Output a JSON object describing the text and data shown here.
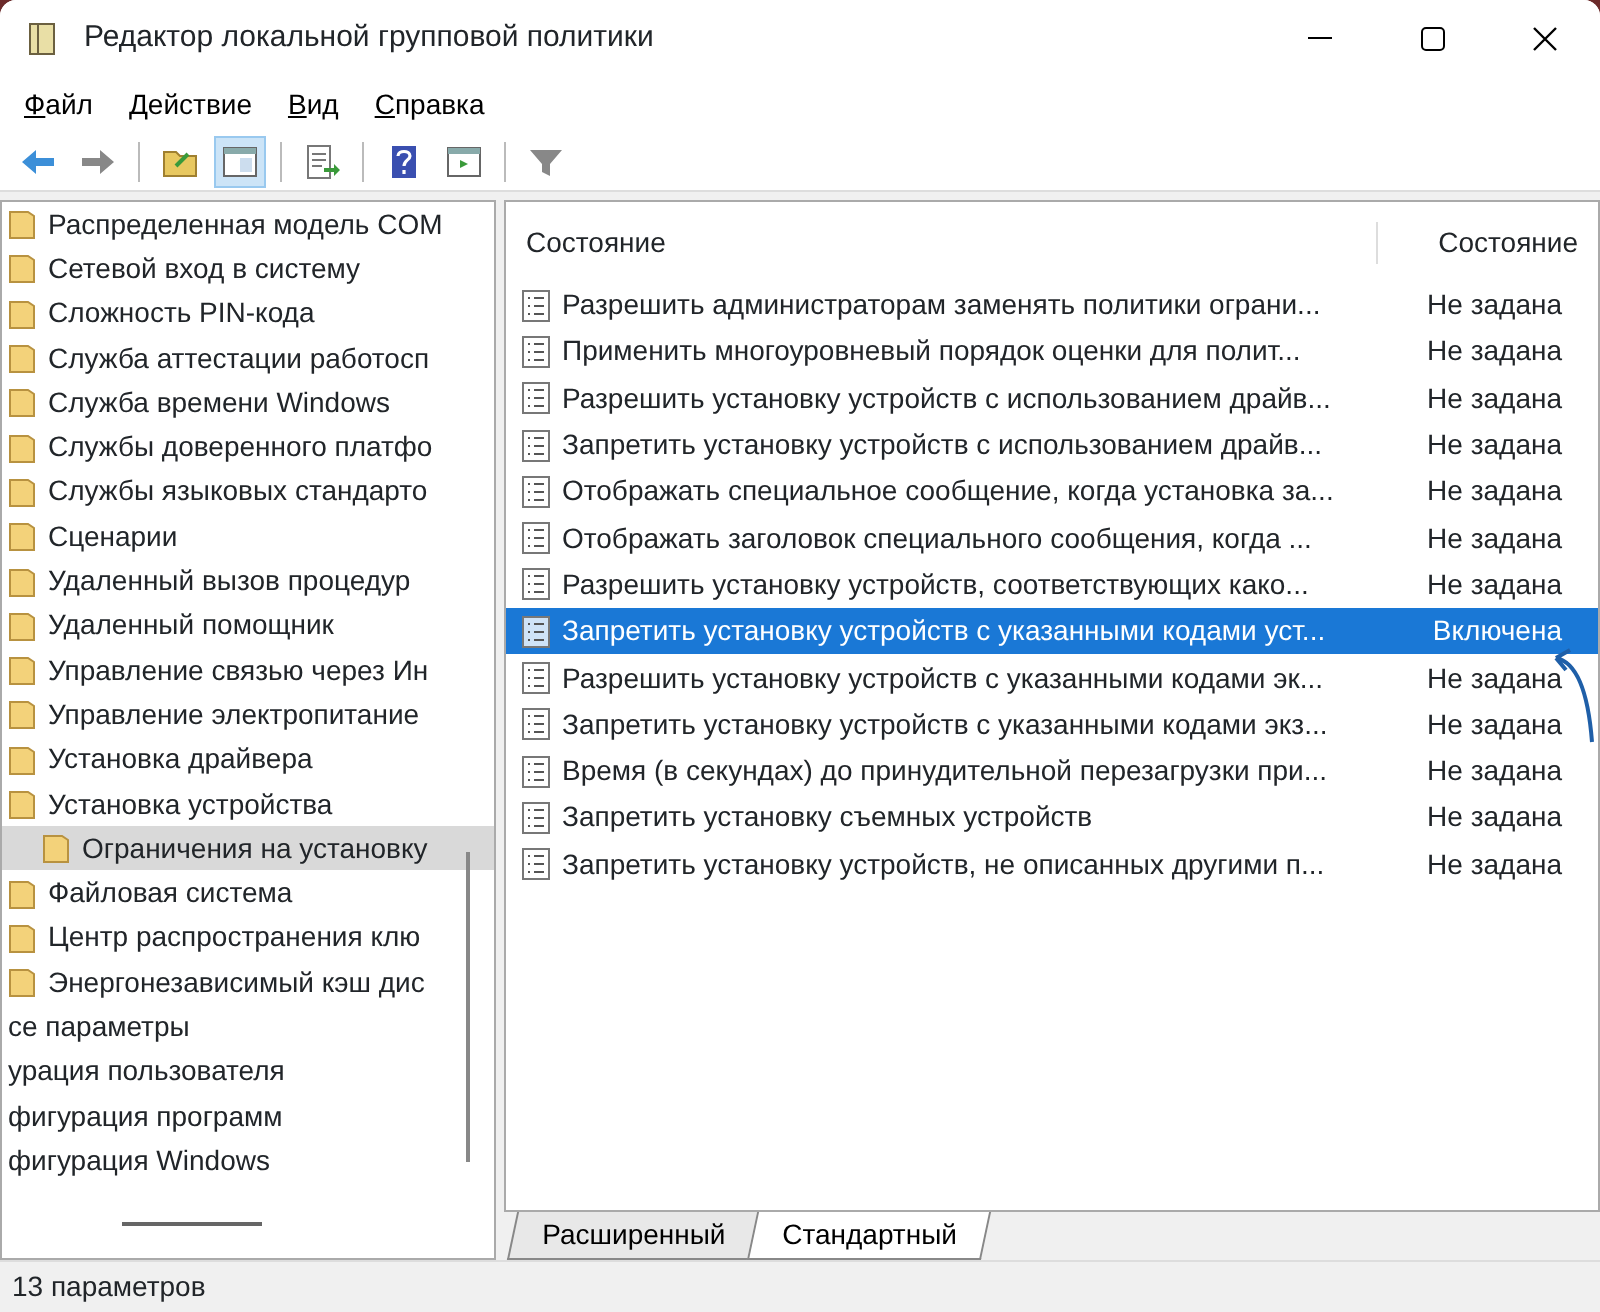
{
  "window": {
    "title": "Редактор локальной групповой политики"
  },
  "menu": [
    "Файл",
    "Действие",
    "Вид",
    "Справка"
  ],
  "toolbar": [
    {
      "kind": "back",
      "pressed": false
    },
    {
      "kind": "forward",
      "pressed": false
    },
    {
      "kind": "sep"
    },
    {
      "kind": "folder",
      "pressed": false
    },
    {
      "kind": "tree",
      "pressed": true
    },
    {
      "kind": "sep"
    },
    {
      "kind": "export",
      "pressed": false
    },
    {
      "kind": "sep"
    },
    {
      "kind": "help",
      "pressed": false
    },
    {
      "kind": "pane",
      "pressed": false
    },
    {
      "kind": "sep"
    },
    {
      "kind": "filter",
      "pressed": false
    }
  ],
  "tree": [
    {
      "label": "Распределенная модель COM",
      "kind": "folder",
      "selected": false
    },
    {
      "label": "Сетевой вход в систему",
      "kind": "folder",
      "selected": false
    },
    {
      "label": "Сложность PIN-кода",
      "kind": "folder",
      "selected": false
    },
    {
      "label": "Служба аттестации работосп",
      "kind": "folder",
      "selected": false
    },
    {
      "label": "Служба времени Windows",
      "kind": "folder",
      "selected": false
    },
    {
      "label": "Службы доверенного платфо",
      "kind": "folder",
      "selected": false
    },
    {
      "label": "Службы языковых стандарто",
      "kind": "folder",
      "selected": false
    },
    {
      "label": "Сценарии",
      "kind": "folder",
      "selected": false
    },
    {
      "label": "Удаленный вызов процедур",
      "kind": "folder",
      "selected": false
    },
    {
      "label": "Удаленный помощник",
      "kind": "folder",
      "selected": false
    },
    {
      "label": "Управление связью через Ин",
      "kind": "folder",
      "selected": false
    },
    {
      "label": "Управление электропитание",
      "kind": "folder",
      "selected": false
    },
    {
      "label": "Установка драйвера",
      "kind": "folder",
      "selected": false
    },
    {
      "label": "Установка устройства",
      "kind": "folder",
      "selected": false,
      "children": [
        {
          "label": "Ограничения на установку",
          "kind": "folder",
          "selected": true
        }
      ]
    },
    {
      "label": "Файловая система",
      "kind": "folder",
      "selected": false
    },
    {
      "label": "Центр распространения клю",
      "kind": "folder",
      "selected": false
    },
    {
      "label": "Энергонезависимый кэш дис",
      "kind": "folder",
      "selected": false
    },
    {
      "label": "ce параметры",
      "kind": "text",
      "selected": false
    },
    {
      "label": "урация пользователя",
      "kind": "text",
      "selected": false
    },
    {
      "label": "фигурация программ",
      "kind": "text",
      "selected": false
    },
    {
      "label": "фигурация Windows",
      "kind": "text",
      "selected": false
    }
  ],
  "table": {
    "columns": [
      "Состояние",
      "Состояние"
    ],
    "rows": [
      {
        "name": "Разрешить администраторам заменять политики ограни...",
        "state": "Не задана",
        "selected": false
      },
      {
        "name": "Применить многоуровневый порядок оценки для полит...",
        "state": "Не задана",
        "selected": false
      },
      {
        "name": "Разрешить установку устройств с использованием драйв...",
        "state": "Не задана",
        "selected": false
      },
      {
        "name": "Запретить установку устройств с использованием драйв...",
        "state": "Не задана",
        "selected": false
      },
      {
        "name": "Отображать специальное сообщение, когда установка за...",
        "state": "Не задана",
        "selected": false
      },
      {
        "name": "Отображать заголовок специального сообщения, когда ...",
        "state": "Не задана",
        "selected": false
      },
      {
        "name": "Разрешить установку устройств, соответствующих како...",
        "state": "Не задана",
        "selected": false
      },
      {
        "name": "Запретить установку устройств с указанными кодами уст...",
        "state": "Включена",
        "selected": true
      },
      {
        "name": "Разрешить установку устройств с указанными кодами эк...",
        "state": "Не задана",
        "selected": false
      },
      {
        "name": "Запретить установку устройств с указанными кодами экз...",
        "state": "Не задана",
        "selected": false
      },
      {
        "name": "Время (в секундах) до принудительной перезагрузки при...",
        "state": "Не задана",
        "selected": false
      },
      {
        "name": "Запретить установку съемных устройств",
        "state": "Не задана",
        "selected": false
      },
      {
        "name": "Запретить установку устройств, не описанных другими п...",
        "state": "Не задана",
        "selected": false
      }
    ]
  },
  "view_tabs": [
    {
      "label": "Расширенный",
      "selected": false
    },
    {
      "label": "Стандартный",
      "selected": true
    }
  ],
  "status_bar": "13 параметров"
}
